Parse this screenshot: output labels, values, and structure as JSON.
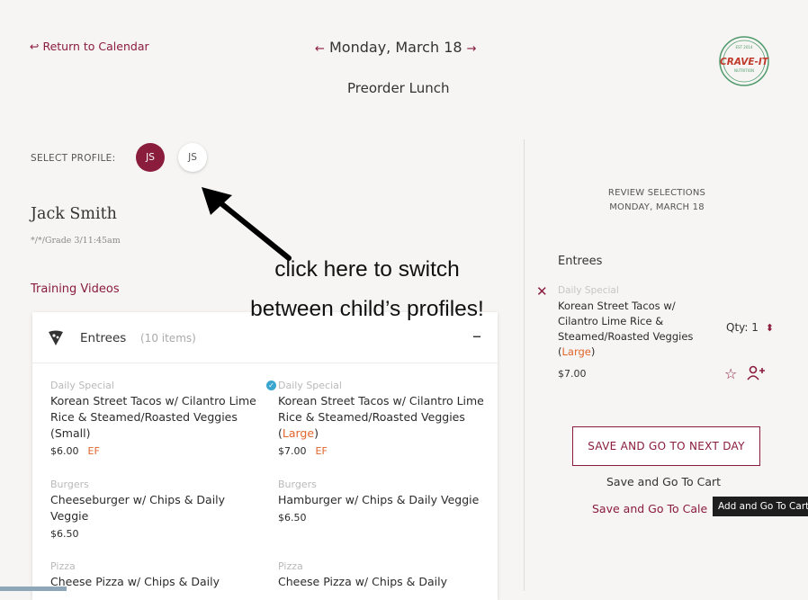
{
  "header": {
    "return_link": "↩ Return to Calendar",
    "prev_arrow": "←",
    "date": "Monday, March 18",
    "next_arrow": "→",
    "title": "Preorder Lunch",
    "logo_top": "EST 2014",
    "logo_main": "CRAVE-IT",
    "logo_bottom": "NUTRITION"
  },
  "profile": {
    "label": "SELECT PROFILE:",
    "avatars": [
      {
        "initials": "JS",
        "selected": true
      },
      {
        "initials": "JS",
        "selected": false
      }
    ],
    "name": "Jack Smith",
    "info": "*/*/Grade 3/11:45am",
    "training_link": "Training Videos"
  },
  "menu": {
    "section": "Entrees",
    "count": "(10 items)",
    "collapse": "–",
    "items": [
      {
        "category": "Daily Special",
        "name": "Korean Street Tacos w/ Cilantro Lime Rice & Steamed/Roasted Veggies (Small)",
        "price": "$6.00",
        "tag": "EF"
      },
      {
        "category": "Daily Special",
        "name_a": "Korean Street Tacos w/ Cilantro Lime Rice & Steamed/Roasted Veggies (",
        "size": "Large",
        "name_b": ")",
        "price": "$7.00",
        "tag": "EF",
        "selected": true
      },
      {
        "category": "Burgers",
        "name": "Cheeseburger w/ Chips & Daily Veggie",
        "price": "$6.50"
      },
      {
        "category": "Burgers",
        "name": "Hamburger w/ Chips & Daily Veggie",
        "price": "$6.50"
      },
      {
        "category": "Pizza",
        "name": "Cheese Pizza w/ Chips & Daily"
      },
      {
        "category": "Pizza",
        "name": "Cheese Pizza w/ Chips & Daily"
      }
    ]
  },
  "review": {
    "heading": "REVIEW SELECTIONS",
    "date": "MONDAY, MARCH 18",
    "section": "Entrees",
    "item_category": "Daily Special",
    "item_name_a": "Korean Street Tacos w/ Cilantro Lime Rice & Steamed/Roasted Veggies (",
    "item_size": "Large",
    "item_name_b": ")",
    "qty_label": "Qty:",
    "qty_value": "1",
    "price": "$7.00",
    "save_next_button": "SAVE AND GO TO NEXT DAY",
    "save_cart_link": "Save and Go To Cart",
    "save_calendar_link": "Save and Go To Cale",
    "tooltip": "Add and Go To Cart"
  },
  "annotation": {
    "line1": "click here to switch",
    "line2": "between child’s profiles!"
  },
  "colors": {
    "accent": "#8a1c3c",
    "highlight": "#e0652d",
    "check": "#3aa6cf"
  }
}
